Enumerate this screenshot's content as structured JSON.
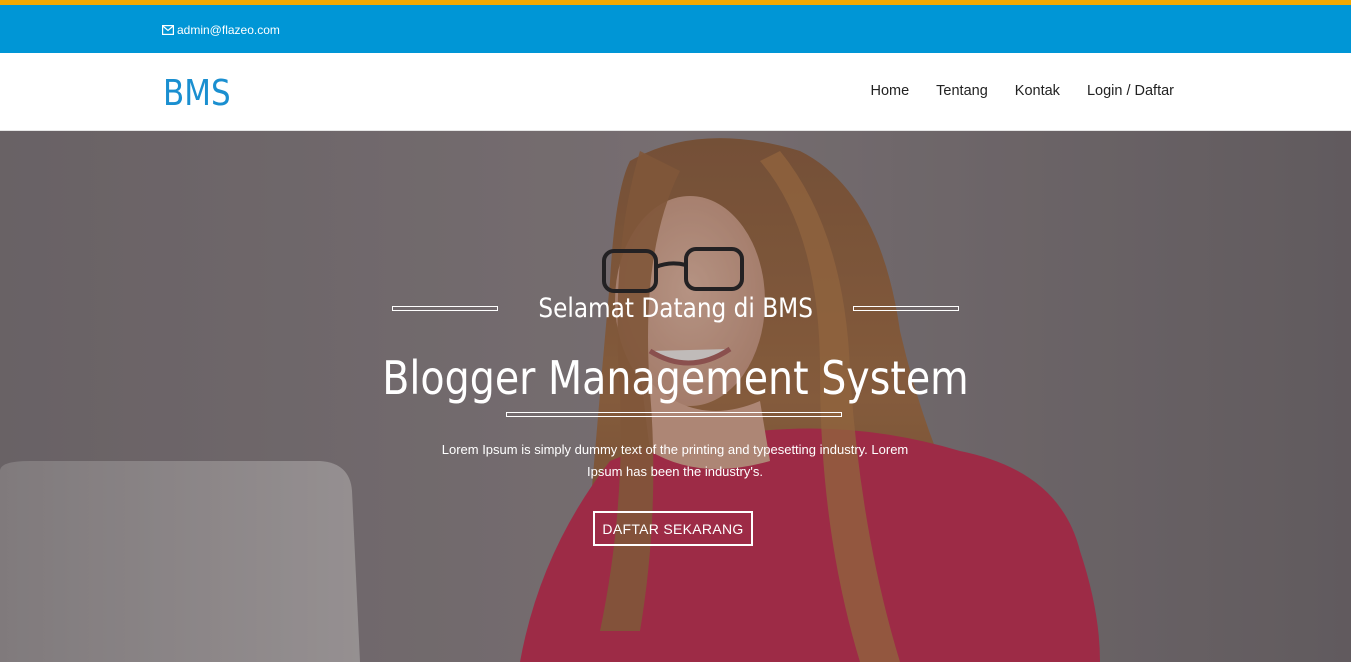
{
  "topbar": {
    "email": "admin@flazeo.com",
    "email_icon": "envelope-icon"
  },
  "navbar": {
    "brand": "BMS",
    "links": [
      "Home",
      "Tentang",
      "Kontak",
      "Login / Daftar"
    ]
  },
  "hero": {
    "subtitle": "Selamat Datang di BMS",
    "title": "Blogger Management System",
    "description": "Lorem Ipsum is simply dummy text of the printing and typesetting industry. Lorem Ipsum has been the industry's.",
    "cta_label": "DAFTAR SEKARANG"
  },
  "colors": {
    "accent": "#f5a800",
    "topbar": "#0096d6",
    "brand": "#1a8fd0",
    "blouse": "#c3274a"
  }
}
